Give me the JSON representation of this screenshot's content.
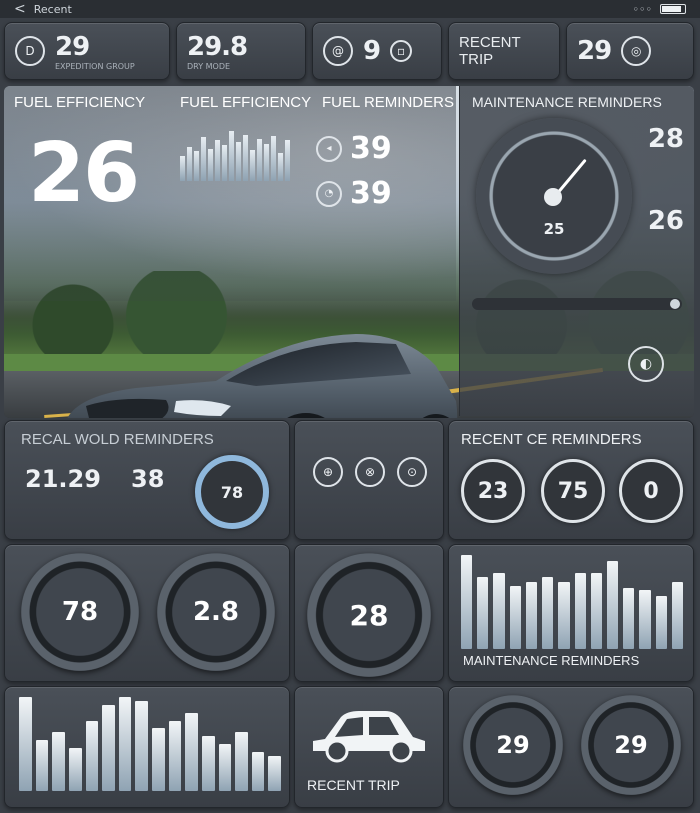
{
  "statusbar": {
    "back": "<",
    "title": "Recent"
  },
  "top_cards": [
    {
      "icon": "D",
      "value": "29",
      "caption": "EXPEDITION GROUP"
    },
    {
      "value": "29.8",
      "caption": "DRY MODE"
    },
    {
      "icon": "@",
      "value": "9"
    },
    {
      "label_line1": "RECENT",
      "label_line2": "TRIP"
    },
    {
      "value": "29"
    }
  ],
  "hero": {
    "title1": "FUEL EFFICIENCY",
    "title2": "FUEL EFFICIENCY",
    "title3": "FUEL REMINDERS",
    "big_value": "26",
    "rem1_value": "39",
    "rem2_value": "39",
    "spark": [
      40,
      55,
      48,
      70,
      52,
      66,
      58,
      80,
      62,
      74,
      50,
      68,
      60,
      72,
      45,
      66
    ]
  },
  "maintenance": {
    "title": "MAINTENANCE REMINDERS",
    "gauge_value": "25",
    "gauge_level": 0.62,
    "side1_value": "28",
    "side2_value": "26"
  },
  "row3": {
    "left_title": "RECAL WOLD REMINDERS",
    "left_val1": "21.29",
    "left_val2": "38",
    "left_ring_value": "78",
    "right_title": "RECENT CE REMINDERS",
    "rings": [
      "23",
      "75",
      "0"
    ]
  },
  "row4": {
    "dial1": "78",
    "dial2": "2.8",
    "speedo": "28",
    "bars_title": "MAINTENANCE REMINDERS",
    "bars": [
      92,
      70,
      74,
      62,
      66,
      70,
      66,
      74,
      74,
      86,
      60,
      58,
      52,
      66
    ]
  },
  "row5": {
    "bars": [
      48,
      26,
      30,
      22,
      36,
      44,
      48,
      46,
      32,
      36,
      40,
      28,
      24,
      30,
      20,
      18
    ],
    "trip_label": "RECENT TRIP",
    "ring1": "29",
    "ring2": "29"
  }
}
